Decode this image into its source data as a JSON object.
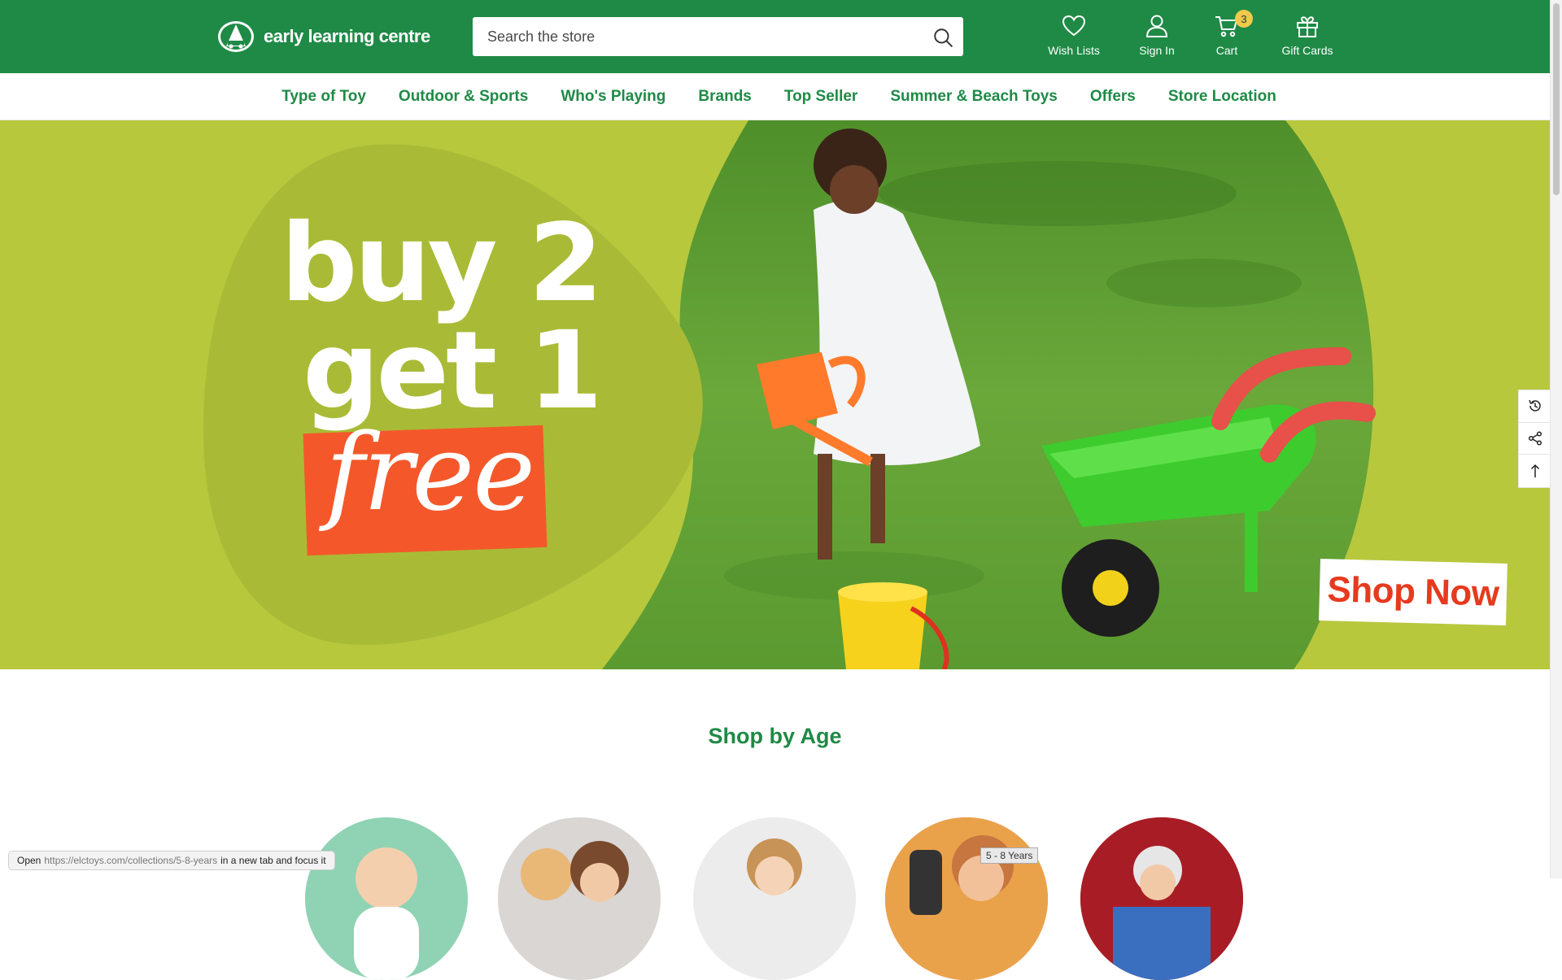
{
  "brand": {
    "name": "early learning centre"
  },
  "search": {
    "placeholder": "Search the store",
    "value": ""
  },
  "header_actions": {
    "wishlist": {
      "label": "Wish Lists",
      "icon": "heart-icon"
    },
    "signin": {
      "label": "Sign In",
      "icon": "user-icon"
    },
    "cart": {
      "label": "Cart",
      "icon": "cart-icon",
      "count": "3"
    },
    "giftcards": {
      "label": "Gift Cards",
      "icon": "gift-icon"
    }
  },
  "nav": {
    "items": [
      {
        "label": "Type of Toy"
      },
      {
        "label": "Outdoor & Sports"
      },
      {
        "label": "Who's Playing"
      },
      {
        "label": "Brands"
      },
      {
        "label": "Top Seller"
      },
      {
        "label": "Summer & Beach Toys"
      },
      {
        "label": "Offers"
      },
      {
        "label": "Store Location"
      }
    ]
  },
  "hero": {
    "line1": "buy 2",
    "line2": "get 1",
    "line3": "free",
    "cta": "Shop Now"
  },
  "side_tools": {
    "recent": "history-icon",
    "share": "share-icon",
    "top": "arrow-up-icon"
  },
  "shop_by_age": {
    "title": "Shop by Age",
    "tag": "5 - 8 Years"
  },
  "status_bar": {
    "prefix": "Open",
    "url": "https://elctoys.com/collections/5-8-years",
    "suffix": "in a new tab and focus it"
  },
  "colors": {
    "brand_green": "#1f8a46",
    "hero_lime": "#b7c83d",
    "promo_orange": "#f4582a",
    "badge_yellow": "#f2c94c"
  }
}
